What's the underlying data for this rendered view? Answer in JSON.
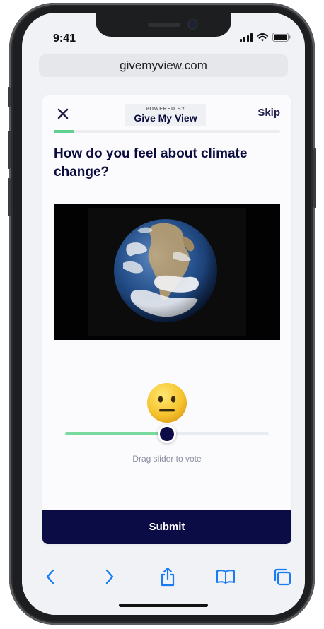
{
  "status_bar": {
    "time": "9:41",
    "icons": [
      "signal-icon",
      "wifi-icon",
      "battery-icon"
    ]
  },
  "browser": {
    "url": "givemyview.com",
    "toolbar_icons": [
      "back-chevron-icon",
      "forward-chevron-icon",
      "share-icon",
      "bookmarks-icon",
      "tabs-icon"
    ]
  },
  "poll": {
    "close_icon": "close-icon",
    "brand_small": "POWERED BY",
    "brand_name": "Give My View",
    "skip_label": "Skip",
    "progress": 0.09,
    "question": "How do you feel about climate change?",
    "media": "earth-globe-image",
    "emoji": "neutral-face-emoji",
    "slider_value": 0.5,
    "slider_hint": "Drag slider to vote",
    "submit_label": "Submit"
  },
  "colors": {
    "navy": "#0b0b45",
    "accent_green": "#79d99e",
    "progress_green": "#5fd08e",
    "card_bg": "#fbfbfd",
    "ios_blue": "#1a7cf5"
  }
}
